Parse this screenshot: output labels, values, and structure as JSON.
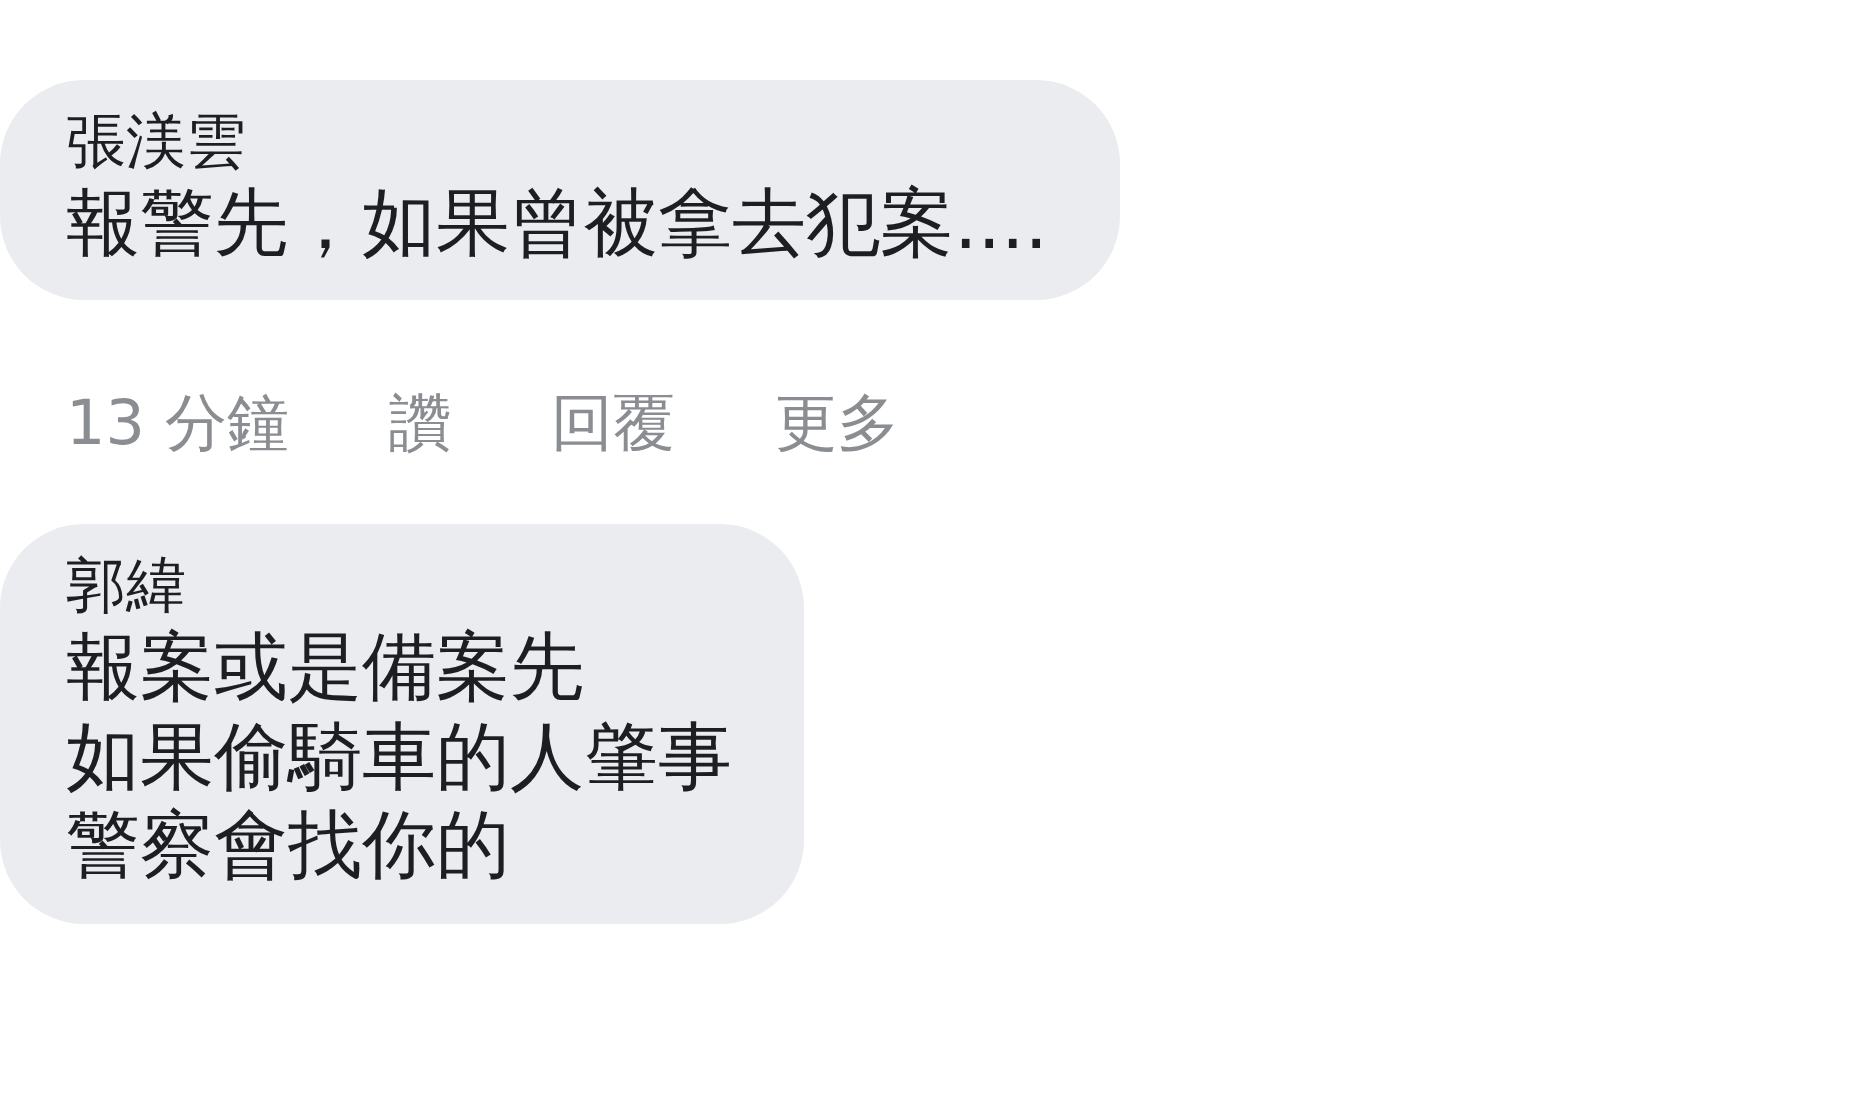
{
  "comments": [
    {
      "author": "張渼雲",
      "lines": [
        "報警先，如果曾被拿去犯案...."
      ],
      "time": "13 分鐘",
      "actions": [
        "讚",
        "回覆",
        "更多"
      ]
    },
    {
      "author": "郭緯",
      "lines": [
        "報案或是備案先",
        "如果偷騎車的人肇事",
        "警察會找你的"
      ]
    }
  ]
}
